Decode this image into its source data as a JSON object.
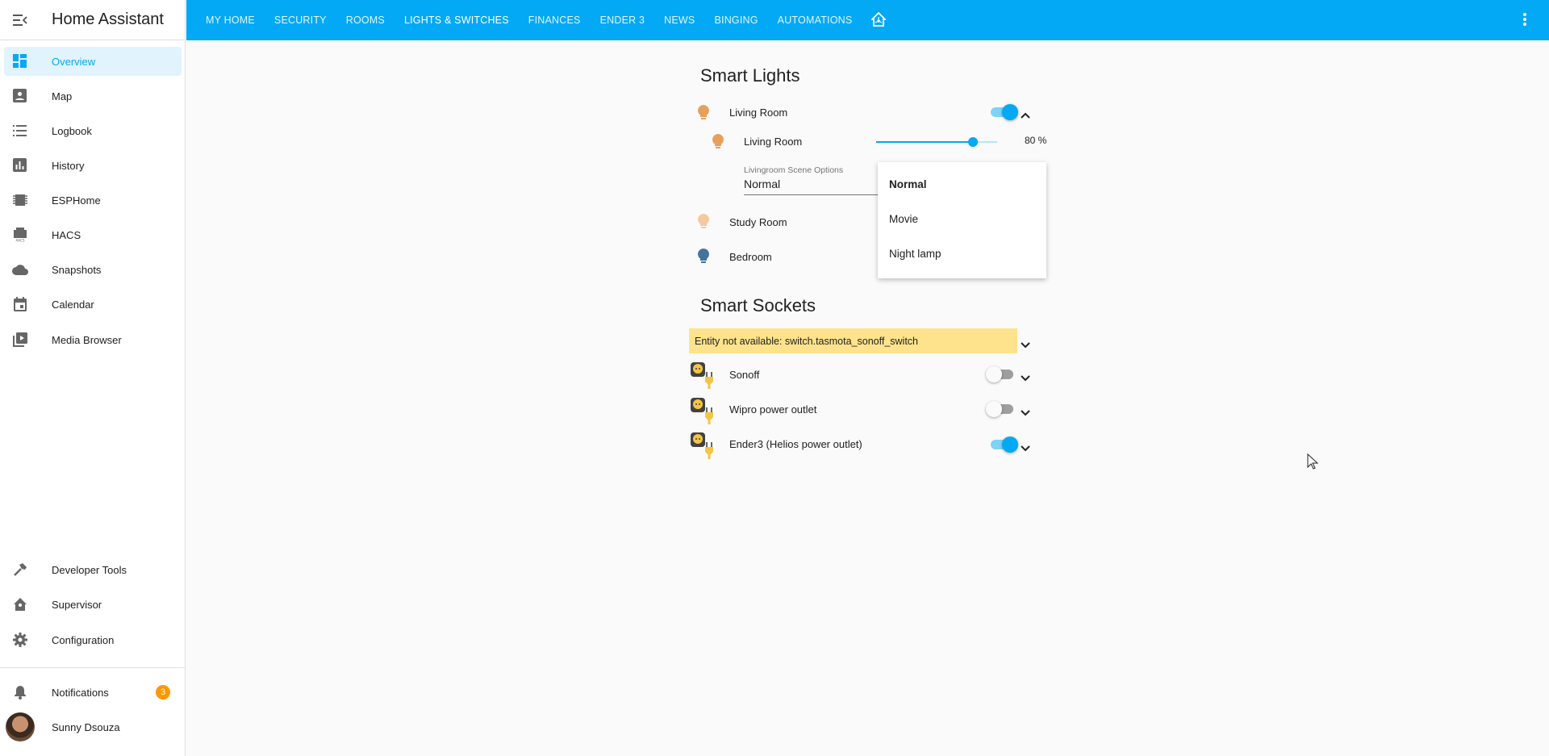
{
  "app": {
    "title": "Home Assistant"
  },
  "sidebar": {
    "items": [
      {
        "label": "Overview",
        "icon": "dashboard-icon",
        "active": true
      },
      {
        "label": "Map",
        "icon": "map-account-icon"
      },
      {
        "label": "Logbook",
        "icon": "list-icon"
      },
      {
        "label": "History",
        "icon": "chart-bar-icon"
      },
      {
        "label": "ESPHome",
        "icon": "chip-icon"
      },
      {
        "label": "HACS",
        "icon": "hacs-icon"
      },
      {
        "label": "Snapshots",
        "icon": "cloud-icon"
      },
      {
        "label": "Calendar",
        "icon": "calendar-icon"
      },
      {
        "label": "Media Browser",
        "icon": "play-box-multiple-icon"
      }
    ],
    "bottom": [
      {
        "label": "Developer Tools",
        "icon": "hammer-icon"
      },
      {
        "label": "Supervisor",
        "icon": "home-assistant-icon"
      },
      {
        "label": "Configuration",
        "icon": "cog-icon"
      }
    ],
    "notifications": {
      "label": "Notifications",
      "count": "3"
    },
    "user": {
      "name": "Sunny Dsouza"
    }
  },
  "tabs": [
    {
      "label": "MY HOME"
    },
    {
      "label": "SECURITY"
    },
    {
      "label": "ROOMS"
    },
    {
      "label": "LIGHTS & SWITCHES",
      "active": true
    },
    {
      "label": "FINANCES"
    },
    {
      "label": "ENDER 3"
    },
    {
      "label": "NEWS"
    },
    {
      "label": "BINGING"
    },
    {
      "label": "AUTOMATIONS"
    }
  ],
  "smart_lights": {
    "title": "Smart Lights",
    "living_room": {
      "name": "Living Room",
      "state": "on"
    },
    "living_room_dimmer": {
      "name": "Living Room",
      "brightness": 80,
      "brightness_text": "80 %"
    },
    "scene_select": {
      "label": "Livingroom Scene Options",
      "value": "Normal",
      "options": [
        "Normal",
        "Movie",
        "Night lamp"
      ]
    },
    "study_room": {
      "name": "Study Room"
    },
    "bedroom": {
      "name": "Bedroom"
    }
  },
  "smart_sockets": {
    "title": "Smart Sockets",
    "warning": "Entity not available: switch.tasmota_sonoff_switch",
    "items": [
      {
        "name": "Sonoff",
        "state": "off"
      },
      {
        "name": "Wipro power outlet",
        "state": "off"
      },
      {
        "name": "Ender3 (Helios power outlet)",
        "state": "on"
      }
    ]
  },
  "colors": {
    "accent": "#03a9f4",
    "bulb_on": "#e7a05c",
    "bulb_dim": "#f5c9a0",
    "bulb_off": "#44739e",
    "warning_bg": "#ffe38c",
    "badge": "#ff9800"
  }
}
